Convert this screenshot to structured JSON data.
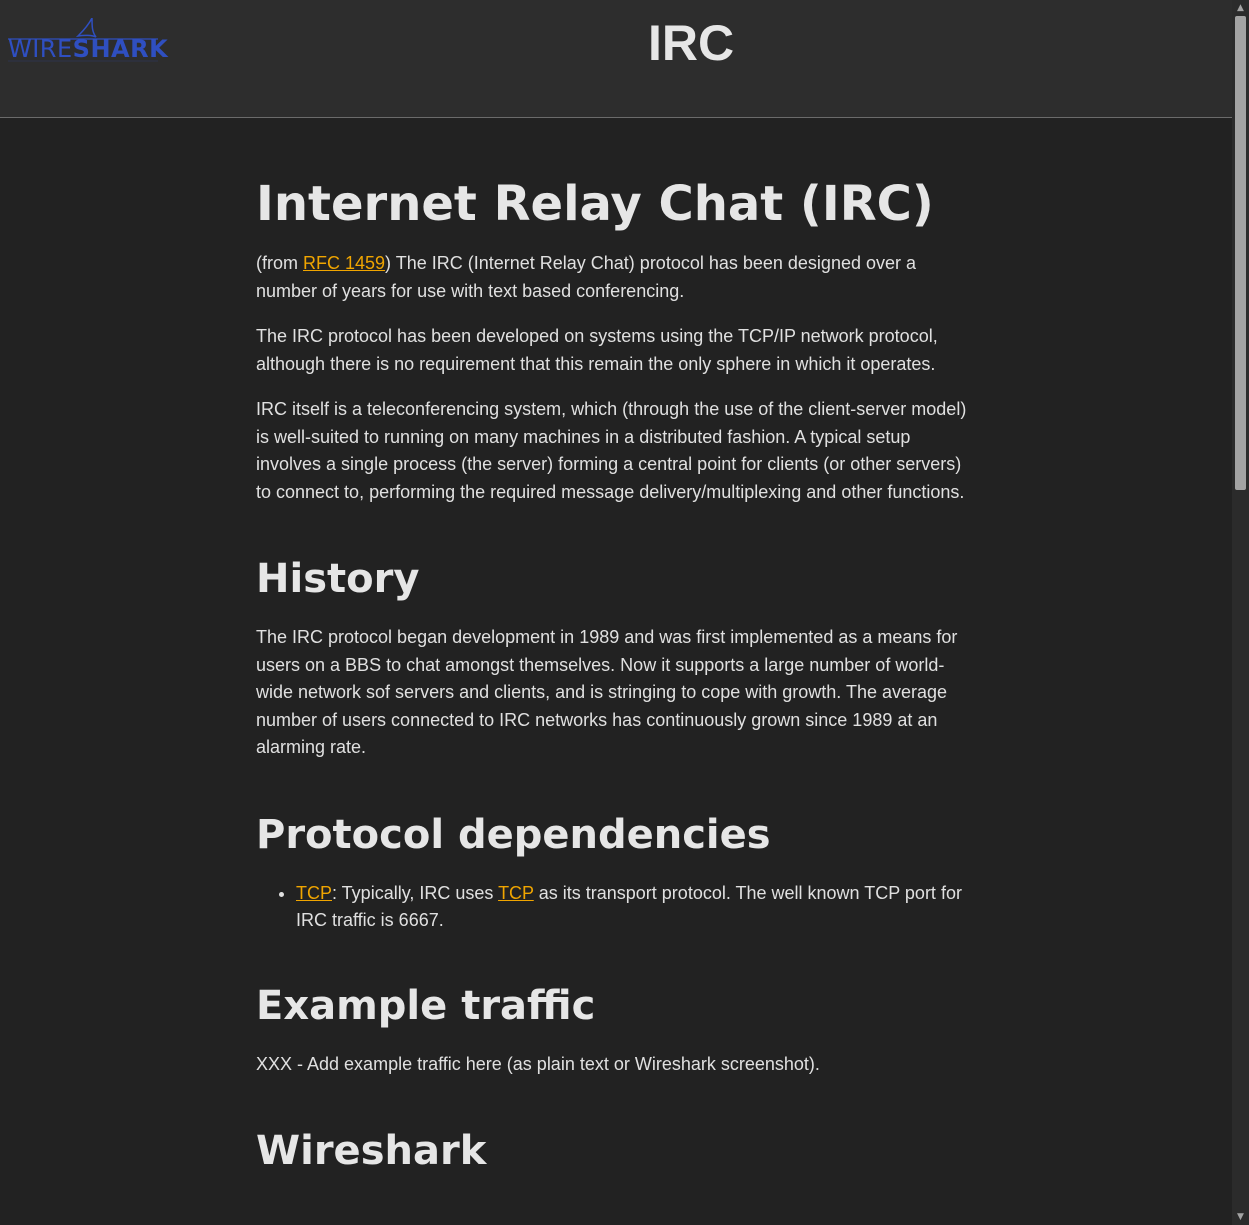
{
  "header": {
    "logo_text_light": "WIRE",
    "logo_text_bold": "SHARK",
    "title": "IRC"
  },
  "article": {
    "title": "Internet Relay Chat (IRC)",
    "intro": {
      "prefix": "(from ",
      "rfc_link": "RFC 1459",
      "suffix": ") The IRC (Internet Relay Chat) protocol has been designed over a number of years for use with text based conferencing."
    },
    "para2": "The IRC protocol has been developed on systems using the TCP/IP network protocol, although there is no requirement that this remain the only sphere in which it operates.",
    "para3": "IRC itself is a teleconferencing system, which (through the use of the client-server model) is well-suited to running on many machines in a distributed fashion. A typical setup involves a single process (the server) forming a central point for clients (or other servers) to connect to, performing the required message delivery/multiplexing and other functions.",
    "history_heading": "History",
    "history_text": "The IRC protocol began development in 1989 and was first implemented as a means for users on a BBS to chat amongst themselves. Now it supports a large number of world-wide network sof servers and clients, and is stringing to cope with growth. The average number of users connected to IRC networks has continuously grown since 1989 at an alarming rate.",
    "deps_heading": "Protocol dependencies",
    "deps_item": {
      "link1": "TCP",
      "text1": ": Typically, IRC uses ",
      "link2": "TCP",
      "text2": " as its transport protocol. The well known TCP port for IRC traffic is 6667."
    },
    "example_heading": "Example traffic",
    "example_text": "XXX - Add example traffic here (as plain text or Wireshark screenshot).",
    "wireshark_heading": "Wireshark"
  },
  "colors": {
    "background": "#222222",
    "header_bg": "#2d2d2d",
    "link": "#f0a500",
    "logo_blue": "#2f4fc0"
  },
  "scrollbar": {
    "up_icon": "▲",
    "down_icon": "▼"
  }
}
